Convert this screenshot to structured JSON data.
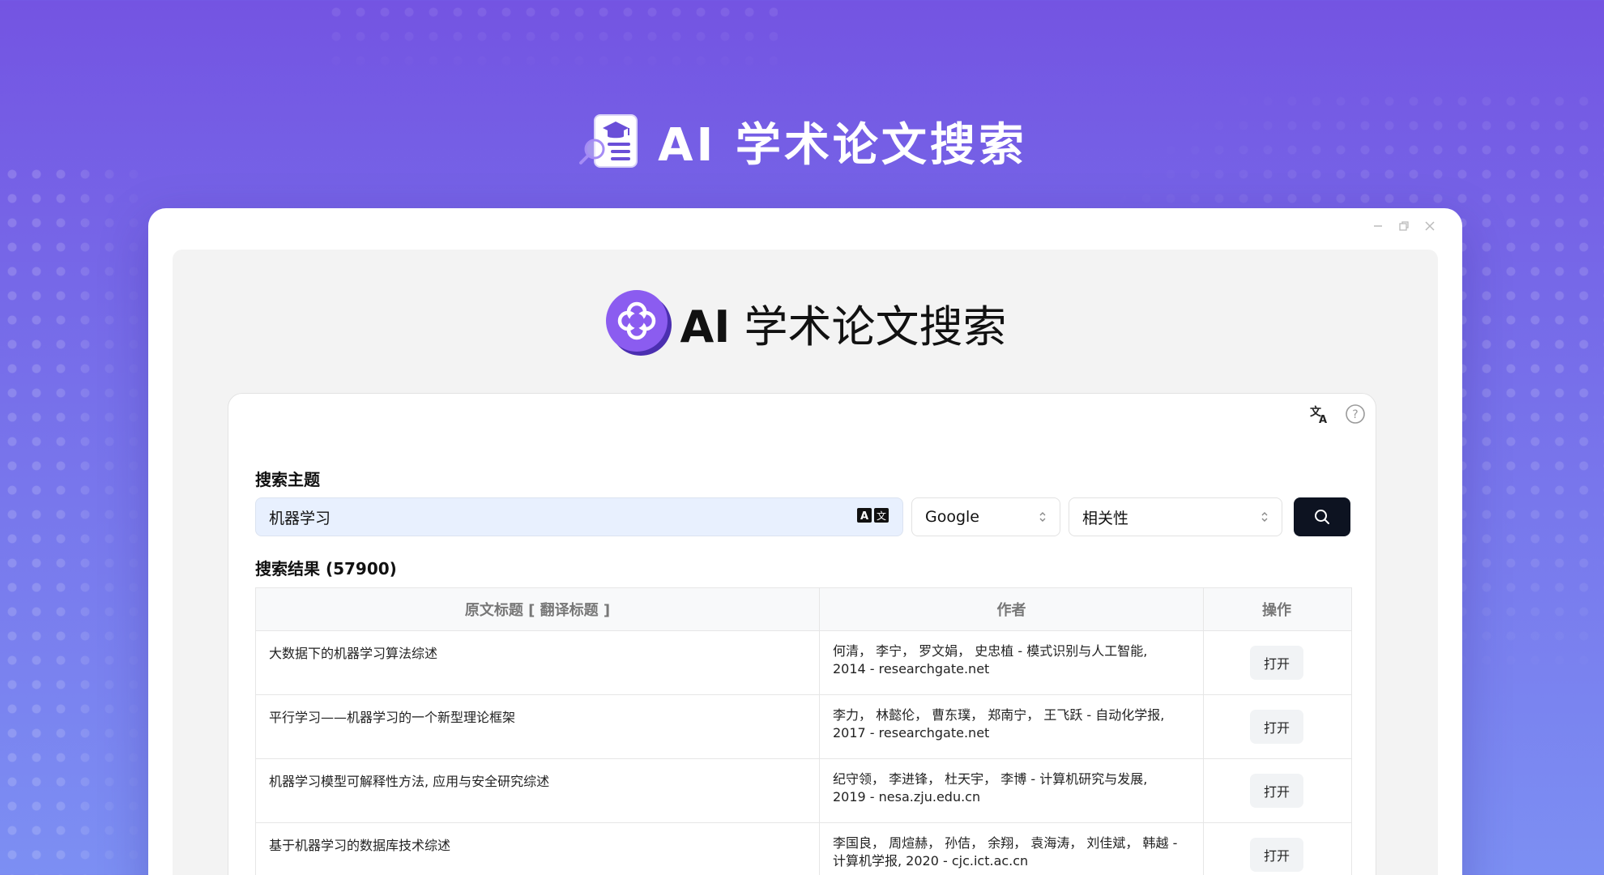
{
  "hero": {
    "title": "AI 学术论文搜索"
  },
  "window": {
    "controls": [
      "minimize",
      "restore",
      "close"
    ]
  },
  "app": {
    "title_ai": "AI",
    "title_rest": " 学术论文搜索"
  },
  "search": {
    "label": "搜索主题",
    "query": "机器学习",
    "engine": "Google",
    "sort": "相关性"
  },
  "results": {
    "title": "搜索结果 (57900)",
    "columns": [
      "原文标题 [ 翻译标题 ]",
      "作者",
      "操作"
    ],
    "rows": [
      {
        "title": "大数据下的机器学习算法综述",
        "authors_line1": "何清， 李宁， 罗文娟， 史忠植 - 模式识别与人工智能,",
        "authors_line2": "2014 - researchgate.net",
        "action": "打开"
      },
      {
        "title": "平行学习——机器学习的一个新型理论框架",
        "authors_line1": "李力， 林懿伦， 曹东璞， 郑南宁， 王飞跃 - 自动化学报,",
        "authors_line2": "2017 - researchgate.net",
        "action": "打开"
      },
      {
        "title": "机器学习模型可解释性方法, 应用与安全研究综述",
        "authors_line1": "纪守领， 李进锋， 杜天宇， 李博 - 计算机研究与发展,",
        "authors_line2": "2019 - nesa.zju.edu.cn",
        "action": "打开"
      },
      {
        "title": "基于机器学习的数据库技术综述",
        "authors_line1": "李国良， 周煊赫， 孙佶， 余翔， 袁海涛， 刘佳斌， 韩越 -",
        "authors_line2": "计算机学报, 2020 - cjc.ict.ac.cn",
        "action": "打开"
      }
    ]
  },
  "colors": {
    "accent": "#7b5ce8",
    "search_button": "#0d1321",
    "input_bg": "#e8f0fe"
  },
  "icons": {
    "hero": "academic-paper-search-icon",
    "app_logo": "flower-logo-icon",
    "translate": "translate-icon",
    "help": "help-circle-icon",
    "input_translate": "translate-ax-icon",
    "search": "search-icon"
  }
}
